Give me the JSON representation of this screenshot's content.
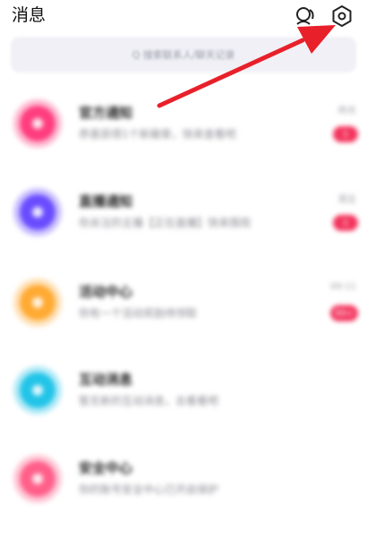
{
  "header": {
    "title": "消息",
    "contacts_icon": "contacts-icon",
    "settings_icon": "settings-gear-icon"
  },
  "search": {
    "placeholder": "Q 搜索联系人/聊天记录"
  },
  "messages": [
    {
      "title": "官方通知",
      "preview": "恭喜获得1个新徽章，快来查看吧",
      "time": "昨天",
      "badge": "1",
      "color": "#ff3d7f",
      "icon": "official-notice-icon"
    },
    {
      "title": "直播通知",
      "preview": "你关注的主播【正在直播】快来围观",
      "time": "周五",
      "badge": "1",
      "color": "#6a4cff",
      "icon": "live-video-icon"
    },
    {
      "title": "活动中心",
      "preview": "你有一个活动奖励待领取",
      "time": "09-11",
      "badge": "99+",
      "color": "#ffaa33",
      "icon": "activity-star-icon"
    },
    {
      "title": "互动消息",
      "preview": "暂无新的互动消息，去看看吧",
      "time": "",
      "badge": "",
      "color": "#22c4e8",
      "icon": "interaction-icon"
    },
    {
      "title": "安全中心",
      "preview": "你的账号安全中心已开启保护",
      "time": "",
      "badge": "",
      "color": "#ff5f8a",
      "icon": "security-center-icon"
    }
  ]
}
